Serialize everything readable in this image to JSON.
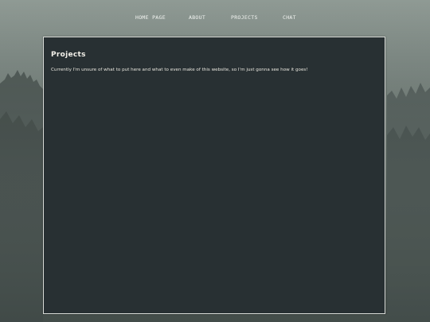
{
  "nav": {
    "items": [
      {
        "label": "HOME PAGE"
      },
      {
        "label": "ABOUT"
      },
      {
        "label": "PROJECTS"
      },
      {
        "label": "CHAT"
      }
    ]
  },
  "main": {
    "title": "Projects",
    "body": "Currently I'm unsure of what to put here and what to even make of this website, so I'm just gonna see how it goes!"
  },
  "colors": {
    "panel_bg": "#283033",
    "panel_border": "#d9dcd8",
    "text": "#f3f1ea"
  }
}
